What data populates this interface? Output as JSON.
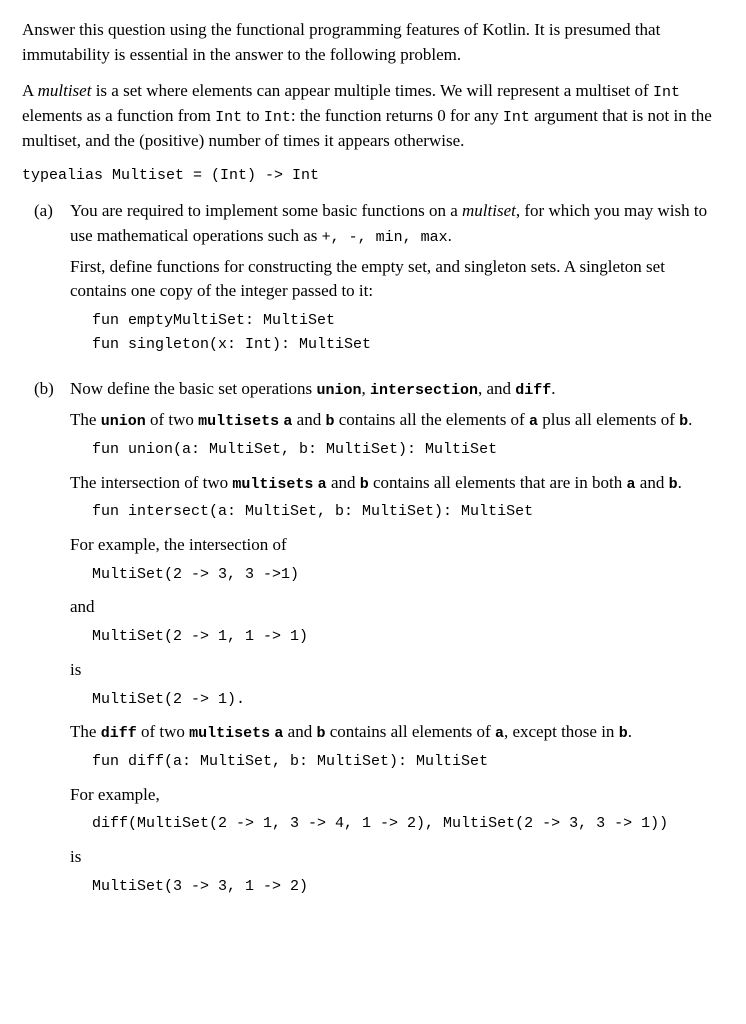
{
  "intro": {
    "p1": "Answer this question using the functional programming features of Kotlin. It is presumed that immutability is essential in the answer to the following problem.",
    "p2_pre": "A ",
    "p2_multiset": "multiset",
    "p2_mid1": " is a set where elements can appear multiple times. We will represent a multiset of ",
    "p2_int1": "Int",
    "p2_mid2": " elements as a function from ",
    "p2_int2": "Int",
    "p2_mid3": " to ",
    "p2_int3": "Int",
    "p2_mid4": ": the function returns 0 for any ",
    "p2_int4": "Int",
    "p2_mid5": " argument that is not in the multiset, and the (positive) number of times it appears otherwise.",
    "typealias": "typealias Multiset = (Int) -> Int"
  },
  "a": {
    "label": "(a)",
    "p1_pre": "You are required to implement some basic functions on a ",
    "p1_multiset": "multiset",
    "p1_mid": ", for which you may wish to use mathematical operations such as ",
    "p1_ops": "+, -, min, max",
    "p1_end": ".",
    "p2": "First, define functions for constructing the empty set, and singleton sets. A singleton set contains one copy of the integer passed to it:",
    "code1": "fun emptyMultiSet: MultiSet",
    "code2": "fun singleton(x: Int): MultiSet"
  },
  "b": {
    "label": "(b)",
    "p1_pre": "Now define the basic set operations ",
    "p1_union": "union",
    "p1_mid1": ", ",
    "p1_intersection": "intersection",
    "p1_mid2": ", and ",
    "p1_diff": "diff",
    "p1_end": ".",
    "union_p_pre": "The ",
    "union_op": "union",
    "union_p_mid1": " of two ",
    "union_ms": "multisets",
    "union_p_mid2": " ",
    "union_a": "a",
    "union_p_mid3": " and ",
    "union_b": "b",
    "union_p_mid4": " contains all the elements of ",
    "union_a2": "a",
    "union_p_mid5": " plus all elements of ",
    "union_b2": "b",
    "union_p_end": ".",
    "union_code": "fun union(a: MultiSet, b: MultiSet): MultiSet",
    "intersect_p_pre": "The intersection of two ",
    "intersect_ms": "multisets",
    "intersect_p_mid1": " ",
    "intersect_a": "a",
    "intersect_p_mid2": " and ",
    "intersect_b": "b",
    "intersect_p_mid3": " contains all elements that are in both ",
    "intersect_a2": "a",
    "intersect_p_mid4": " and ",
    "intersect_b2": "b",
    "intersect_p_end": ".",
    "intersect_code": "fun intersect(a: MultiSet, b: MultiSet): MultiSet",
    "intersect_ex_pre": "For example, the intersection of",
    "intersect_ex_a": "MultiSet(2 -> 3, 3 ->1)",
    "intersect_and": "and",
    "intersect_ex_b": "MultiSet(2 -> 1, 1 -> 1)",
    "intersect_is": "is",
    "intersect_result": "MultiSet(2 -> 1).",
    "diff_p_pre": "The ",
    "diff_op": "diff",
    "diff_p_mid1": " of two ",
    "diff_ms": "multisets",
    "diff_p_mid2": " ",
    "diff_a": "a",
    "diff_p_mid3": " and ",
    "diff_b": "b",
    "diff_p_mid4": " contains all elements of ",
    "diff_a2": "a",
    "diff_p_mid5": ", except those in ",
    "diff_b2": "b",
    "diff_p_end": ".",
    "diff_code": "fun diff(a: MultiSet, b: MultiSet): MultiSet",
    "diff_ex_pre": "For example,",
    "diff_ex_call": "diff(MultiSet(2 -> 1, 3 -> 4, 1 -> 2), MultiSet(2 -> 3, 3 -> 1))",
    "diff_is": "is",
    "diff_result": "MultiSet(3 -> 3, 1 -> 2)"
  }
}
